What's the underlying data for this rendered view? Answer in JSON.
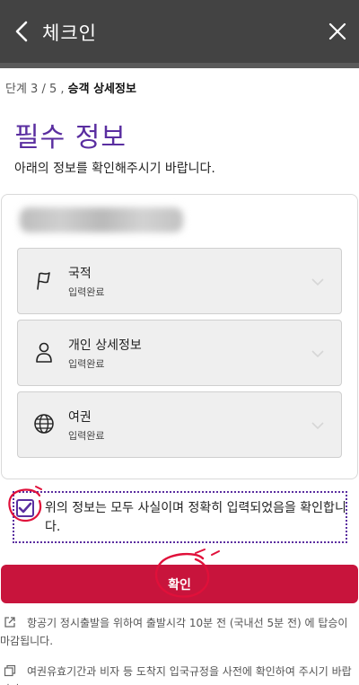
{
  "header": {
    "title": "체크인",
    "back_icon": "chevron-left-icon",
    "close_icon": "close-icon"
  },
  "step": {
    "prefix": "단계 3 / 5 ,",
    "current": "승객 상세정보"
  },
  "section": {
    "title": "필수 정보",
    "subtitle": "아래의 정보를 확인해주시기 바랍니다."
  },
  "passenger": {
    "name_redacted": true
  },
  "items": [
    {
      "label": "국적",
      "status": "입력완료",
      "icon": "flag-icon"
    },
    {
      "label": "개인 상세정보",
      "status": "입력완료",
      "icon": "person-icon"
    },
    {
      "label": "여권",
      "status": "입력완료",
      "icon": "globe-icon"
    }
  ],
  "confirm": {
    "checked": true,
    "text": "위의 정보는 모두 사실이며 정확히 입력되었음을 확인합니다."
  },
  "button": {
    "label": "확인"
  },
  "notes": [
    "항공기 정시출발을 위하여 출발시각 10분 전 (국내선 5분 전) 에 탑승이 마감됩니다.",
    "여권유효기간과 비자 등 도착지 입국규정을 사전에 확인하여 주시기 바랍니다"
  ],
  "colors": {
    "header": "#434343",
    "accent": "#5a2ea0",
    "button": "#c8143c",
    "annotation": "#e0103a"
  }
}
